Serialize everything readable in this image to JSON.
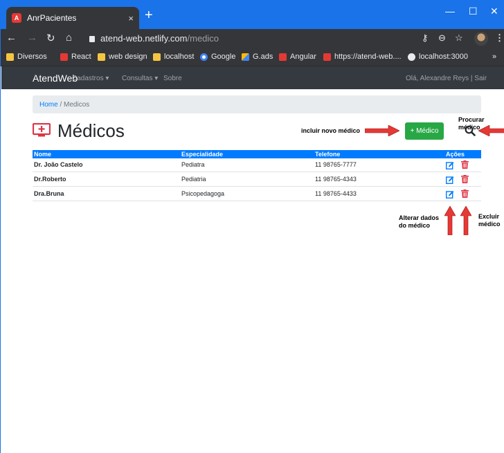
{
  "browser": {
    "tab_title": "AnrPacientes",
    "tab_close": "×",
    "new_tab": "+",
    "url_host": "atend-web.netlify.com",
    "url_path": "/medico",
    "bookmarks": [
      "Diversos",
      "React",
      "web design",
      "localhost",
      "Google",
      "G.ads",
      "Angular",
      "https://atend-web....",
      "localhost:3000"
    ],
    "bookmarks_more": "»"
  },
  "app": {
    "brand": "AtendWeb",
    "nav": [
      "Cadastros ▾",
      "Consultas ▾",
      "Sobre"
    ],
    "greeting": "Olá, Alexandre Reys | Sair"
  },
  "breadcrumb": {
    "home": "Home",
    "separator": " / ",
    "current": "Medicos"
  },
  "page": {
    "title": "Médicos",
    "add_button": "+ Médico"
  },
  "annotations": {
    "add_new": "incluir novo médico",
    "search": "Procurar médico",
    "edit_line1": "Alterar dados",
    "edit_line2": "do médico",
    "delete_line1": "Excluir",
    "delete_line2": "médico"
  },
  "table": {
    "headers": [
      "Nome",
      "Especialidade",
      "Telefone",
      "Ações"
    ],
    "rows": [
      {
        "nome": "Dr. João Castelo",
        "especialidade": "Pediatra",
        "telefone": "11 98765-7777"
      },
      {
        "nome": "Dr.Roberto",
        "especialidade": "Pediatria",
        "telefone": "11 98765-4343"
      },
      {
        "nome": "Dra.Bruna",
        "especialidade": "Psicopedagoga",
        "telefone": "11 98765-4433"
      }
    ]
  },
  "colors": {
    "chrome_accent": "#1a73e8",
    "navbar": "#343a40",
    "primary": "#007bff",
    "success": "#28a745",
    "danger": "#dc3545",
    "annotation_arrow": "#e53935"
  }
}
